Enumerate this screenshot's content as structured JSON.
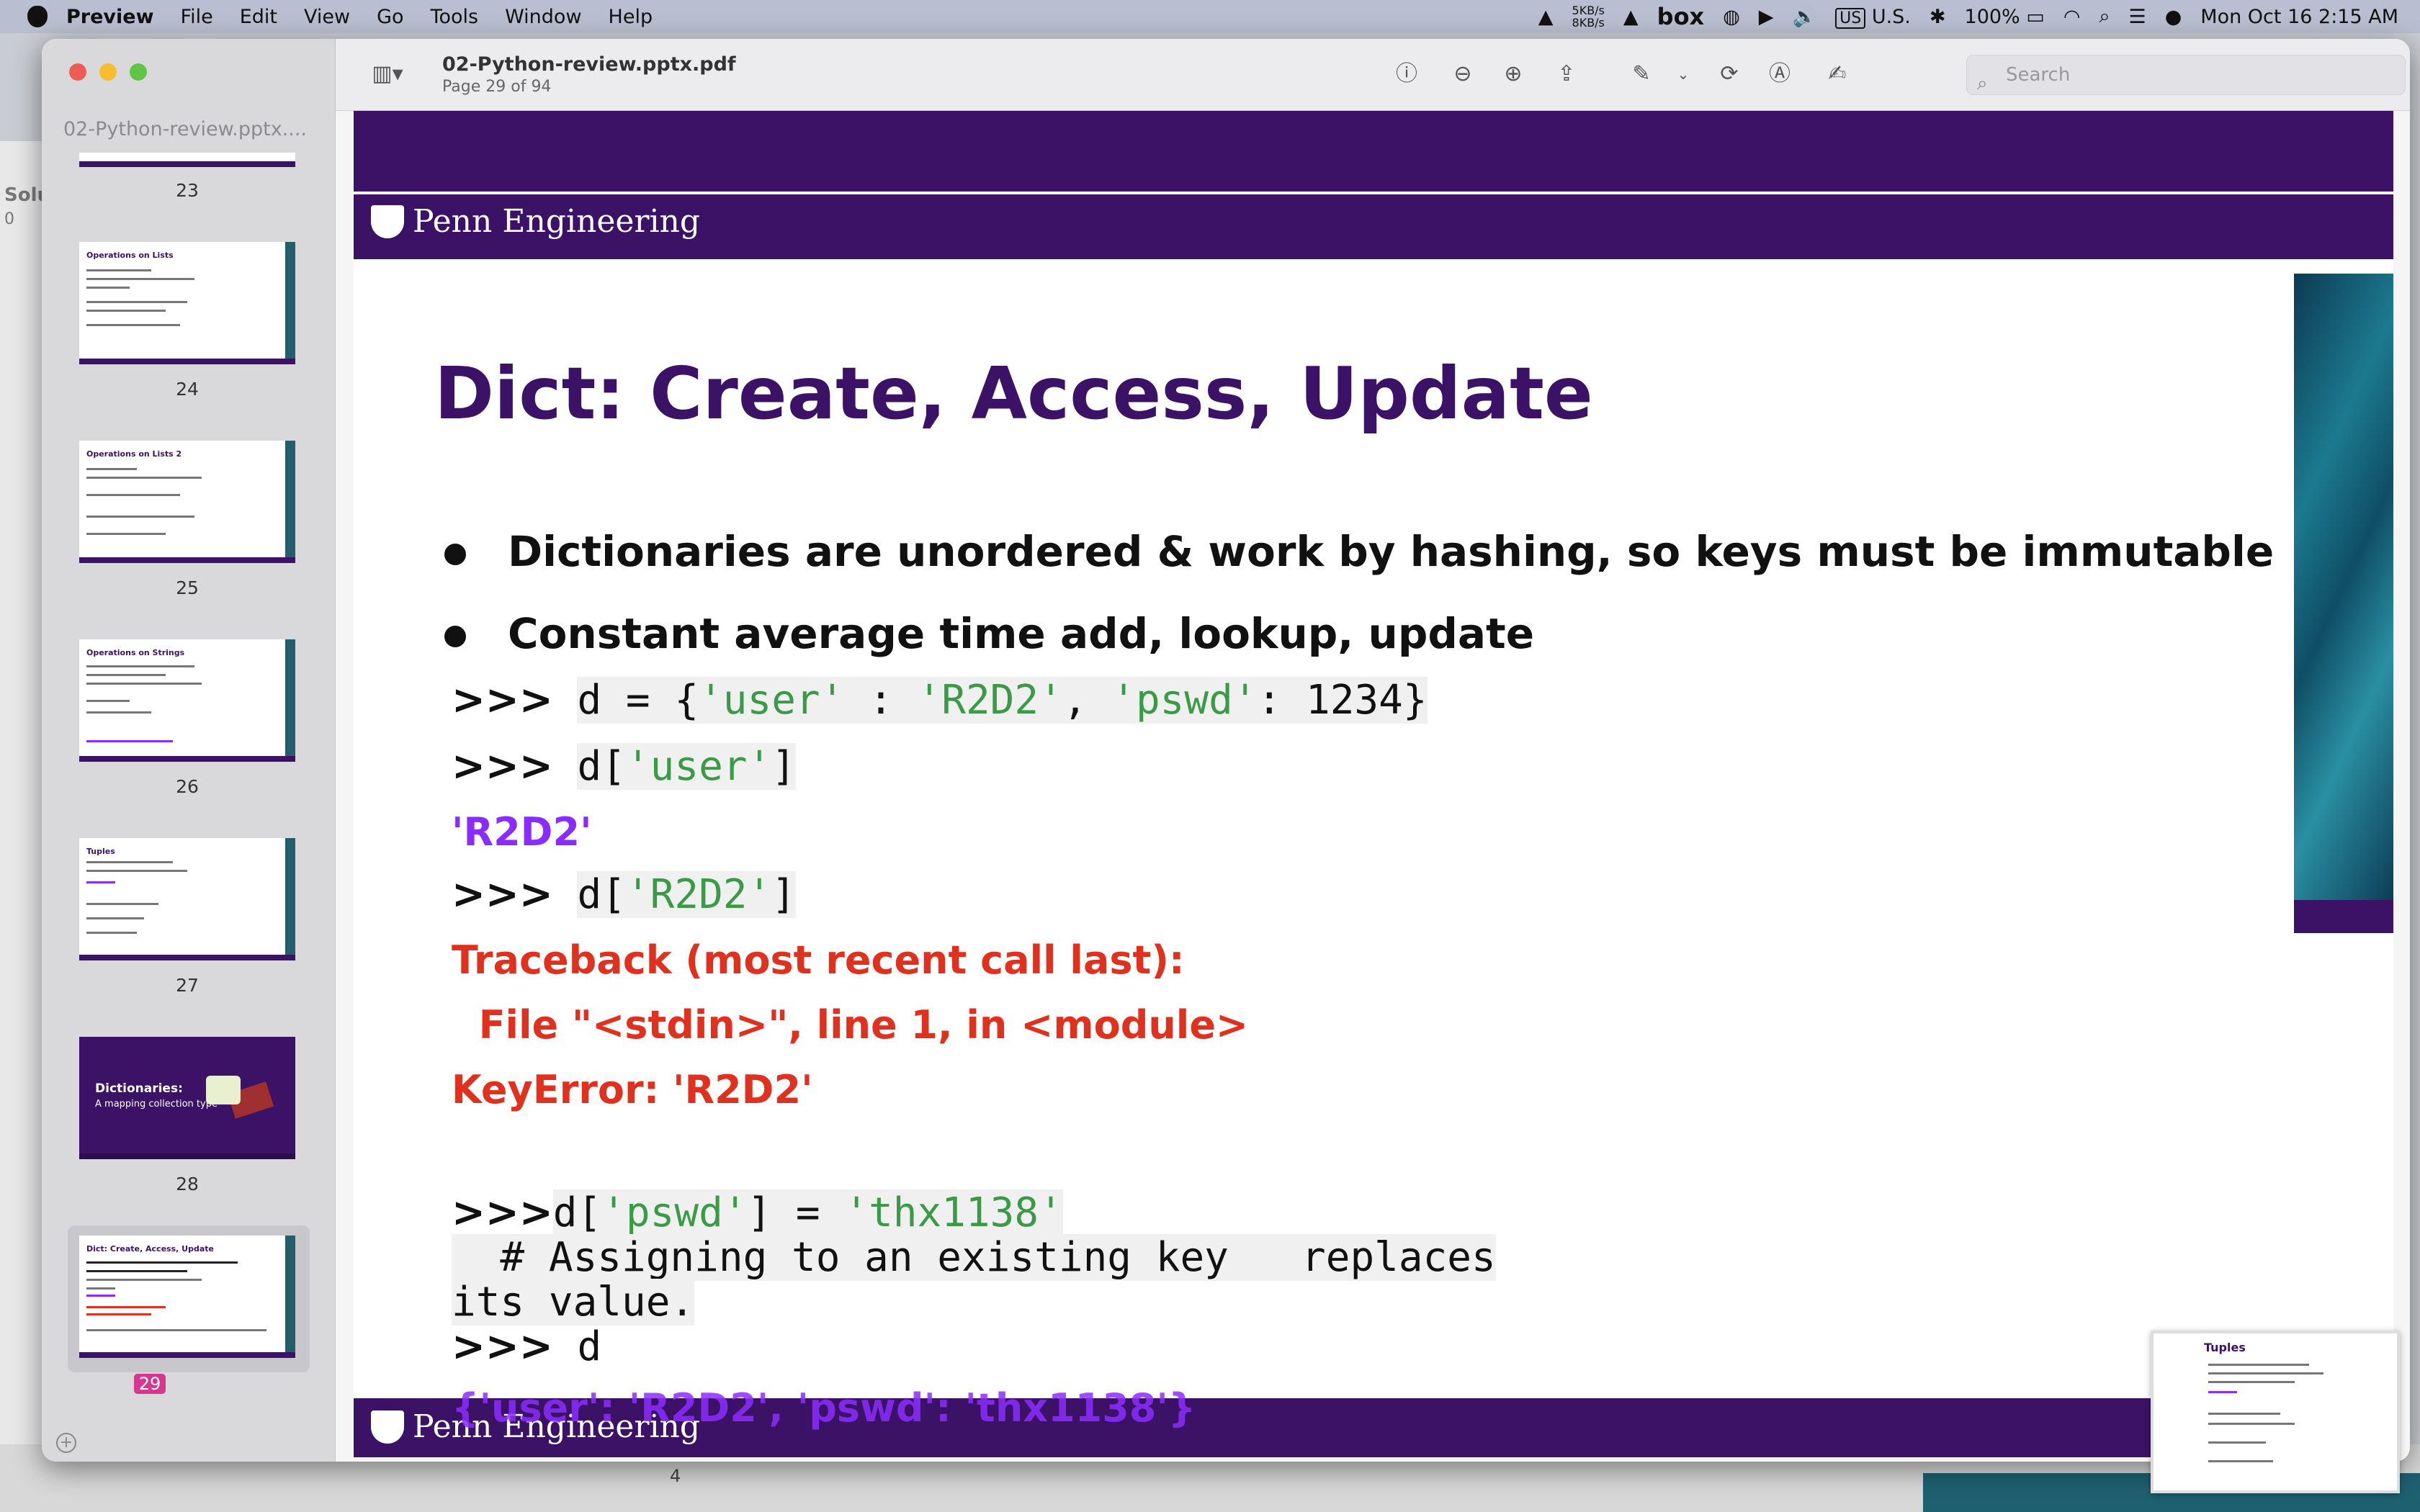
{
  "menubar": {
    "items": [
      "Preview",
      "File",
      "Edit",
      "View",
      "Go",
      "Tools",
      "Window",
      "Help"
    ],
    "net_up": "5KB/s",
    "net_down": "8KB/s",
    "box": "box",
    "input_source": "US",
    "input_label": "U.S.",
    "battery": "100%",
    "datetime": "Mon Oct 16  2:15 AM"
  },
  "background": {
    "left_label": "Solu",
    "left_sub": "0",
    "bottom_num": "4"
  },
  "sidebar": {
    "doc_name": "02-Python-review.pptx....",
    "thumbnails": [
      {
        "page": "23",
        "title": ""
      },
      {
        "page": "24",
        "title": "Operations on Lists"
      },
      {
        "page": "25",
        "title": "Operations on Lists 2"
      },
      {
        "page": "26",
        "title": "Operations on Strings"
      },
      {
        "page": "27",
        "title": "Tuples"
      },
      {
        "page": "28",
        "title": "Dictionaries:",
        "subtitle": "A mapping collection type"
      },
      {
        "page": "29",
        "title": "Dict: Create, Access, Update",
        "selected": true
      }
    ]
  },
  "toolbar": {
    "title": "02-Python-review.pptx.pdf",
    "subtitle": "Page 29 of 94",
    "search_placeholder": "Search"
  },
  "slide": {
    "brand": "Penn Engineering",
    "title": "Dict: Create, Access, Update",
    "bullets": [
      "Dictionaries are unordered & work by hashing, so keys must be immutable",
      "Constant average time add, lookup, update"
    ],
    "prompt": ">>>",
    "code1_pre": "d = {",
    "code1_k1": "'user'",
    "code1_sep1": " : ",
    "code1_v1": "'R2D2'",
    "code1_comma": ", ",
    "code1_k2": "'pswd'",
    "code1_rest": ":  1234}",
    "code2_pre": "d[",
    "code2_key": "'user'",
    "code2_post": "]",
    "out1": "'R2D2'",
    "code3_pre": "d[",
    "code3_key": "'R2D2'",
    "code3_post": "]",
    "err1": "Traceback (most recent call last):",
    "err2": "  File \"<stdin>\", line 1, in <module>",
    "err3": "KeyError: 'R2D2'",
    "code4_pre": "d[",
    "code4_key": "'pswd'",
    "code4_mid": "] = ",
    "code4_val": "'thx1138'",
    "code4_comment": "  # Assigning to an existing key   replaces",
    "code4_cont": "its value.",
    "code5": "d",
    "out2": "{'user': 'R2D2', 'pswd': 'thx1138'}"
  },
  "mini": {
    "title": "Tuples"
  },
  "colors": {
    "penn_purple": "#3b1266",
    "output_purple": "#8b2cff",
    "error_red": "#e0301e",
    "string_green": "#3a9a46",
    "selected_page": "#d4378d"
  }
}
